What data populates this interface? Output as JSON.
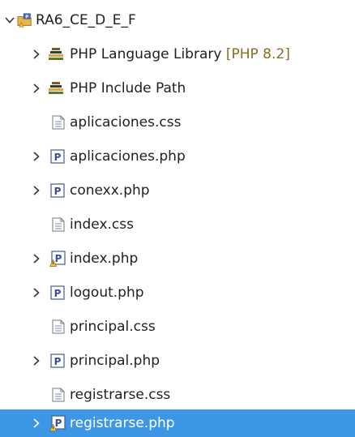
{
  "project": {
    "name": "RA6_CE_D_E_F"
  },
  "items": [
    {
      "label": "PHP Language Library",
      "decoration": "[PHP 8.2]",
      "icon": "library-icon",
      "expandable": true
    },
    {
      "label": "PHP Include Path",
      "icon": "library-icon",
      "expandable": true
    },
    {
      "label": "aplicaciones.css",
      "icon": "css-file-icon",
      "expandable": false
    },
    {
      "label": "aplicaciones.php",
      "icon": "php-file-icon",
      "expandable": true
    },
    {
      "label": "conexx.php",
      "icon": "php-file-icon",
      "expandable": true
    },
    {
      "label": "index.css",
      "icon": "css-file-icon",
      "expandable": false
    },
    {
      "label": "index.php",
      "icon": "php-file-warning-icon",
      "expandable": true
    },
    {
      "label": "logout.php",
      "icon": "php-file-icon",
      "expandable": true
    },
    {
      "label": "principal.css",
      "icon": "css-file-icon",
      "expandable": false
    },
    {
      "label": "principal.php",
      "icon": "php-file-icon",
      "expandable": true
    },
    {
      "label": "registrarse.css",
      "icon": "css-file-icon",
      "expandable": false
    },
    {
      "label": "registrarse.php",
      "icon": "php-file-warning-icon",
      "expandable": true,
      "selected": true
    }
  ],
  "colors": {
    "selection": "#3d97e6",
    "decoration": "#8a6d1e",
    "text": "#1f1f1f"
  }
}
